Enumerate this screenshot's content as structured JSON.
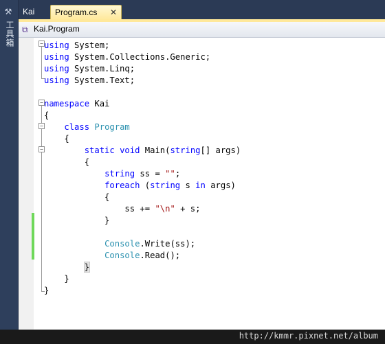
{
  "toolbox": {
    "icon": "toolbox-icon",
    "label": "工具箱"
  },
  "tabs": [
    {
      "label": "Kai",
      "active": false
    },
    {
      "label": "Program.cs",
      "active": true,
      "close": "✕"
    }
  ],
  "navbar": {
    "class_icon": "class-icon",
    "selection": "Kai.Program"
  },
  "code": {
    "lines": [
      [
        [
          "kw",
          "using"
        ],
        [
          "p",
          " System;"
        ]
      ],
      [
        [
          "kw",
          "using"
        ],
        [
          "p",
          " System.Collections.Generic;"
        ]
      ],
      [
        [
          "kw",
          "using"
        ],
        [
          "p",
          " System.Linq;"
        ]
      ],
      [
        [
          "kw",
          "using"
        ],
        [
          "p",
          " System.Text;"
        ]
      ],
      [],
      [
        [
          "kw",
          "namespace"
        ],
        [
          "p",
          " Kai"
        ]
      ],
      [
        [
          "p",
          "{"
        ]
      ],
      [
        [
          "p",
          "    "
        ],
        [
          "kw",
          "class"
        ],
        [
          "p",
          " "
        ],
        [
          "ty",
          "Program"
        ]
      ],
      [
        [
          "p",
          "    {"
        ]
      ],
      [
        [
          "p",
          "        "
        ],
        [
          "kw",
          "static"
        ],
        [
          "p",
          " "
        ],
        [
          "kw",
          "void"
        ],
        [
          "p",
          " Main("
        ],
        [
          "kw",
          "string"
        ],
        [
          "p",
          "[] args)"
        ]
      ],
      [
        [
          "p",
          "        {"
        ]
      ],
      [
        [
          "p",
          "            "
        ],
        [
          "kw",
          "string"
        ],
        [
          "p",
          " ss = "
        ],
        [
          "st",
          "\"\""
        ],
        [
          "p",
          ";"
        ]
      ],
      [
        [
          "p",
          "            "
        ],
        [
          "kw",
          "foreach"
        ],
        [
          "p",
          " ("
        ],
        [
          "kw",
          "string"
        ],
        [
          "p",
          " s "
        ],
        [
          "kw",
          "in"
        ],
        [
          "p",
          " args)"
        ]
      ],
      [
        [
          "p",
          "            {"
        ]
      ],
      [
        [
          "p",
          "                ss += "
        ],
        [
          "st",
          "\"\\n\""
        ],
        [
          "p",
          " + s;"
        ]
      ],
      [
        [
          "p",
          "            }"
        ]
      ],
      [],
      [
        [
          "p",
          "            "
        ],
        [
          "ty",
          "Console"
        ],
        [
          "p",
          ".Write(ss);"
        ]
      ],
      [
        [
          "p",
          "            "
        ],
        [
          "ty",
          "Console"
        ],
        [
          "p",
          ".Read();"
        ]
      ],
      [
        [
          "p",
          "        "
        ],
        [
          "caret",
          "}"
        ]
      ],
      [
        [
          "p",
          "    }"
        ]
      ],
      [
        [
          "p",
          "}"
        ]
      ]
    ]
  },
  "colors": {
    "keyword": "#0000ff",
    "type": "#2b91af",
    "string": "#a31515",
    "changed_line": "#6fd85a",
    "active_tab": "#ffe89a"
  },
  "footer": {
    "watermark": "http://kmmr.pixnet.net/album"
  }
}
